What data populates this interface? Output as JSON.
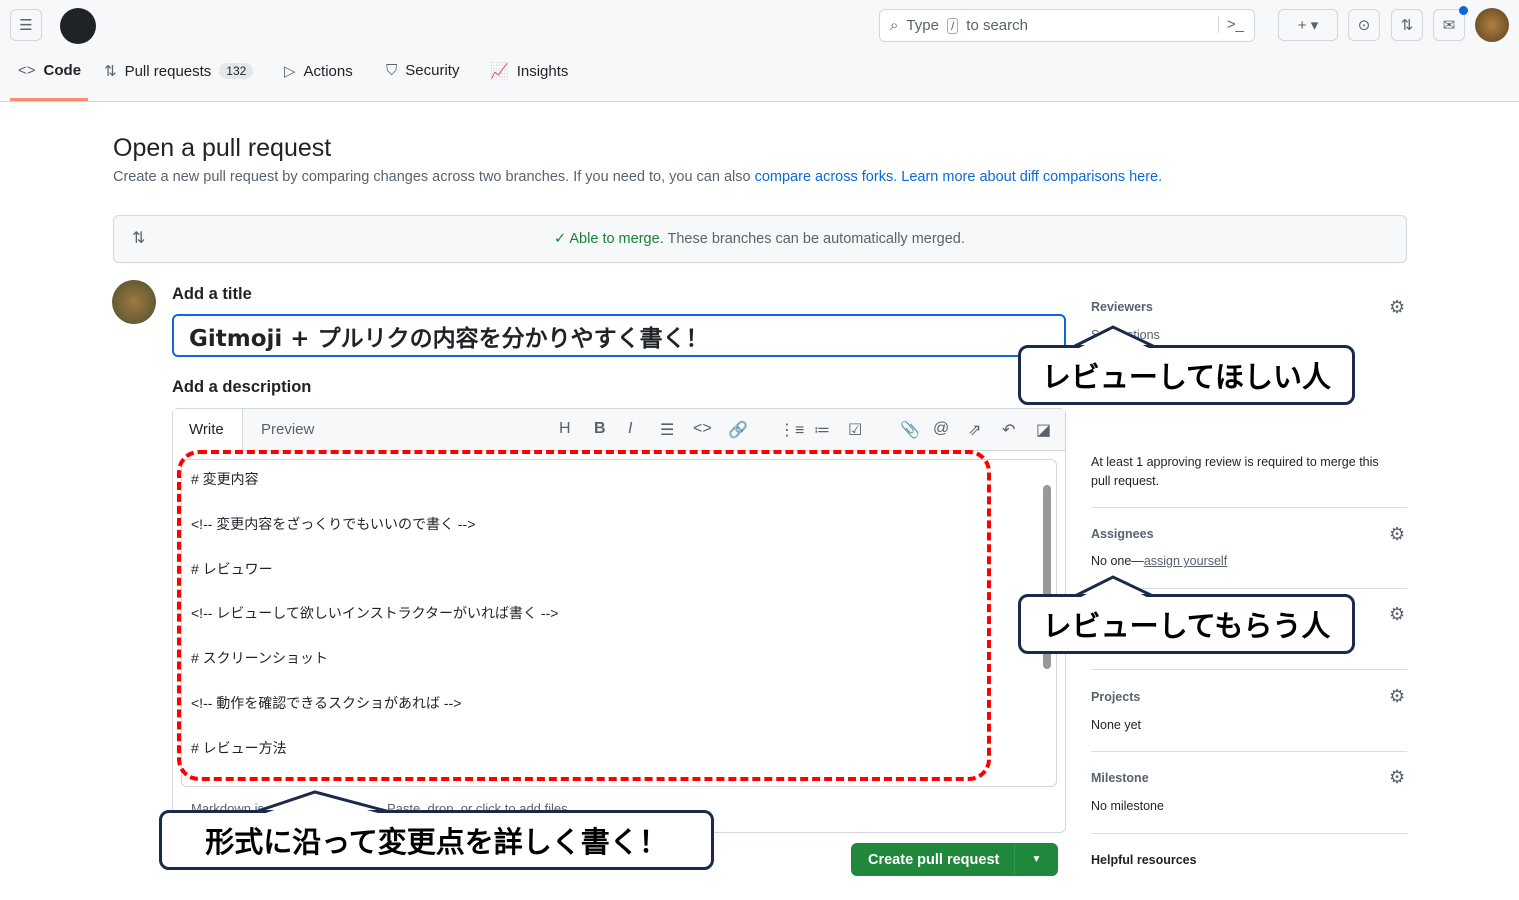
{
  "header": {
    "search_placeholder_pre": "Type",
    "search_key": "/",
    "search_placeholder_post": "to search"
  },
  "tabs": [
    {
      "label": "Code",
      "icon": "code-icon"
    },
    {
      "label": "Pull requests",
      "count": "132",
      "icon": "git-pull-request-icon"
    },
    {
      "label": "Actions",
      "icon": "play-icon"
    },
    {
      "label": "Security",
      "icon": "shield-icon"
    },
    {
      "label": "Insights",
      "icon": "graph-icon"
    }
  ],
  "page": {
    "title": "Open a pull request",
    "subtitle": "Create a new pull request by comparing changes across two branches. If you need to, you can also",
    "link1": "compare across forks.",
    "link2": "Learn more about diff comparisons here."
  },
  "merge": {
    "status": "Able to merge.",
    "message": "These branches can be automatically merged."
  },
  "form": {
    "title_label": "Add a title",
    "title_value": "Gitmoji + プルリクの内容を分かりやすく書く！",
    "desc_label": "Add a description",
    "write_tab": "Write",
    "preview_tab": "Preview",
    "body_lines": [
      "# 変更内容",
      "<!-- 変更内容をざっくりでもいいので書く -->",
      "# レビュワー",
      "<!-- レビューして欲しいインストラクターがいれば書く -->",
      "# スクリーンショット",
      "<!-- 動作を確認できるスクショがあれば -->",
      "# レビュー方法"
    ],
    "markdown_note": "Markdown is supported",
    "attach_note": "Paste, drop, or click to add files",
    "submit": "Create pull request"
  },
  "sidebar": {
    "reviewers": "Reviewers",
    "suggestions": "Suggestions",
    "review_required": "At least 1 approving review is required to merge this pull request.",
    "assignees": "Assignees",
    "no_one": "No one—",
    "assign_yourself": "assign yourself",
    "projects": "Projects",
    "none_yet": "None yet",
    "milestone": "Milestone",
    "no_milestone": "No milestone",
    "helpful": "Helpful resources"
  },
  "annotations": {
    "reviewers_callout": "レビューしてほしい人",
    "assignees_callout": "レビューしてもらう人",
    "description_callout": "形式に沿って変更点を詳しく書く！"
  },
  "colors": {
    "accent": "#0969da",
    "success": "#1f883d",
    "annotation_red": "#ff0000",
    "callout_border": "#1c2a4a"
  }
}
